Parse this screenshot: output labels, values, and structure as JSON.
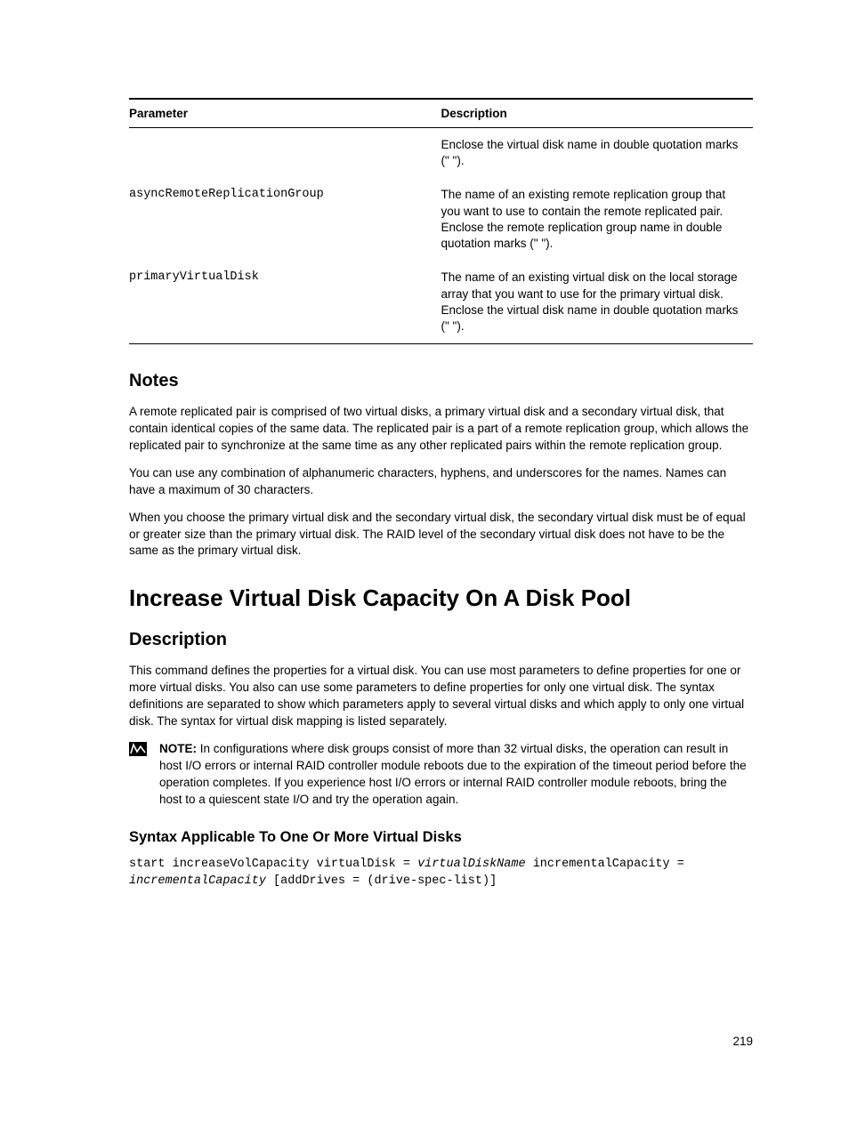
{
  "table": {
    "header_param": "Parameter",
    "header_desc": "Description",
    "rows": [
      {
        "param": "",
        "desc": "Enclose the virtual disk name in double quotation marks (\" \")."
      },
      {
        "param": "asyncRemoteReplicationGroup",
        "desc": "The name of an existing remote replication group that you want to use to contain the remote replicated pair. Enclose the remote replication group name in double quotation marks (\" \")."
      },
      {
        "param": "primaryVirtualDisk",
        "desc": "The name of an existing virtual disk on the local storage array that you want to use for the primary virtual disk. Enclose the virtual disk name in double quotation marks (\" \")."
      }
    ]
  },
  "notes": {
    "heading": "Notes",
    "p1": "A remote replicated pair is comprised of two virtual disks, a primary virtual disk and a secondary virtual disk, that contain identical copies of the same data. The replicated pair is a part of a remote replication group, which allows the replicated pair to synchronize at the same time as any other replicated pairs within the remote replication group.",
    "p2": "You can use any combination of alphanumeric characters, hyphens, and underscores for the names. Names can have a maximum of 30 characters.",
    "p3": "When you choose the primary virtual disk and the secondary virtual disk, the secondary virtual disk must be of equal or greater size than the primary virtual disk. The RAID level of the secondary virtual disk does not have to be the same as the primary virtual disk."
  },
  "section": {
    "heading": "Increase Virtual Disk Capacity On A Disk Pool",
    "desc_heading": "Description",
    "desc_p": "This command defines the properties for a virtual disk. You can use most parameters to define properties for one or more virtual disks. You also can use some parameters to define properties for only one virtual disk. The syntax definitions are separated to show which parameters apply to several virtual disks and which apply to only one virtual disk. The syntax for virtual disk mapping is listed separately.",
    "note_label": "NOTE: ",
    "note_text": "In configurations where disk groups consist of more than 32 virtual disks, the operation can result in host I/O errors or internal RAID controller module reboots due to the expiration of the timeout period before the operation completes. If you experience host I/O errors or internal RAID controller module reboots, bring the host to a quiescent state I/O and try the operation again.",
    "syntax_heading": "Syntax Applicable To One Or More Virtual Disks",
    "syntax_pre1": "start increaseVolCapacity virtualDisk = ",
    "syntax_ital1": "virtualDiskName",
    "syntax_mid1": " incrementalCapacity = ",
    "syntax_ital2": "incrementalCapacity",
    "syntax_post": " [addDrives = (drive-spec-list)]"
  },
  "page_number": "219"
}
